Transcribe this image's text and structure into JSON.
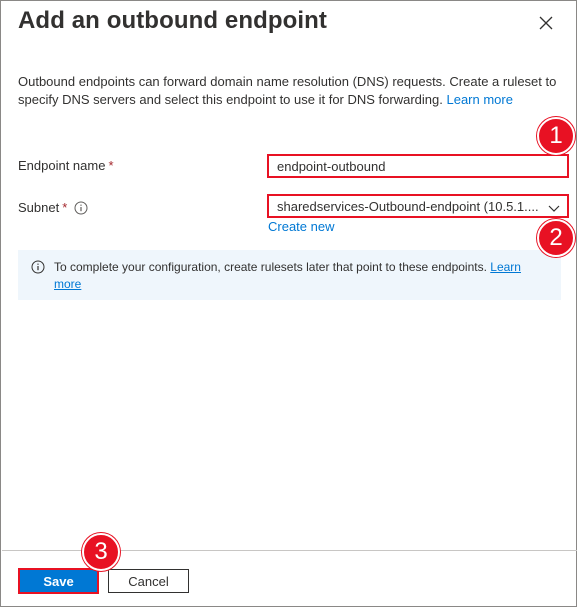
{
  "dialog": {
    "title": "Add an outbound endpoint",
    "description": "Outbound endpoints can forward domain name resolution (DNS) requests. Create a ruleset to specify DNS servers and select this endpoint to use it for DNS forwarding.",
    "learn_more": "Learn more"
  },
  "form": {
    "endpoint_name_label": "Endpoint name",
    "endpoint_name_value": "endpoint-outbound",
    "subnet_label": "Subnet",
    "required_mark": "*",
    "subnet_value": "sharedservices-Outbound-endpoint (10.5.1....",
    "create_new": "Create new"
  },
  "infobar": {
    "text": "To complete your configuration, create rulesets later that point to these endpoints.",
    "learn_more": "Learn more"
  },
  "footer": {
    "save_label": "Save",
    "cancel_label": "Cancel"
  },
  "callouts": [
    "1",
    "2",
    "3"
  ],
  "colors": {
    "accent": "#0078d4",
    "highlight": "#e81123",
    "info_bg": "#eff6fc"
  },
  "icons": [
    "close-icon",
    "info-icon",
    "chevron-down-icon"
  ]
}
